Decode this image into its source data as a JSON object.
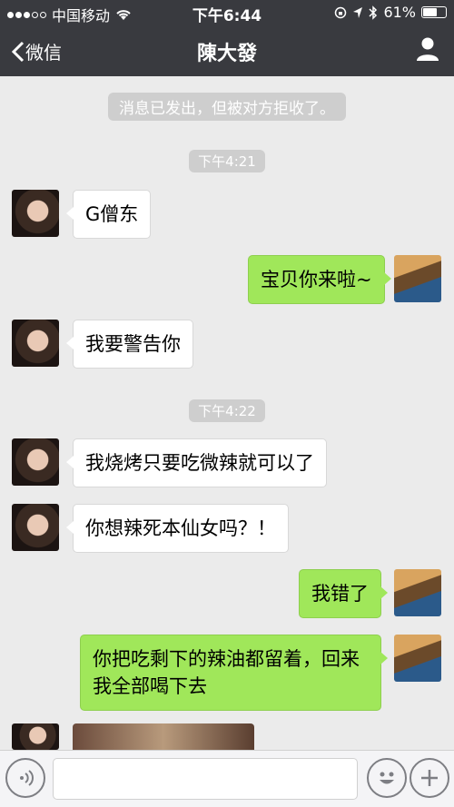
{
  "status": {
    "carrier": "中国移动",
    "time": "下午6:44",
    "battery": "61%"
  },
  "nav": {
    "back_label": "微信",
    "title": "陳大發"
  },
  "system_notice": "消息已发出，但被对方拒收了。",
  "timestamps": [
    "下午4:21",
    "下午4:22"
  ],
  "messages": [
    {
      "side": "left",
      "text": "G僧东"
    },
    {
      "side": "right",
      "text": "宝贝你来啦~"
    },
    {
      "side": "left",
      "text": "我要警告你"
    },
    {
      "side": "left",
      "text": "我烧烤只要吃微辣就可以了"
    },
    {
      "side": "left",
      "text": "你想辣死本仙女吗？！"
    },
    {
      "side": "right",
      "text": "我错了"
    },
    {
      "side": "right",
      "text": "你把吃剩下的辣油都留着，回来\n我全部喝下去"
    }
  ],
  "colors": {
    "header": "#393a3f",
    "chat_bg": "#ebebeb",
    "right_bubble": "#a0e75a",
    "left_bubble": "#ffffff"
  }
}
